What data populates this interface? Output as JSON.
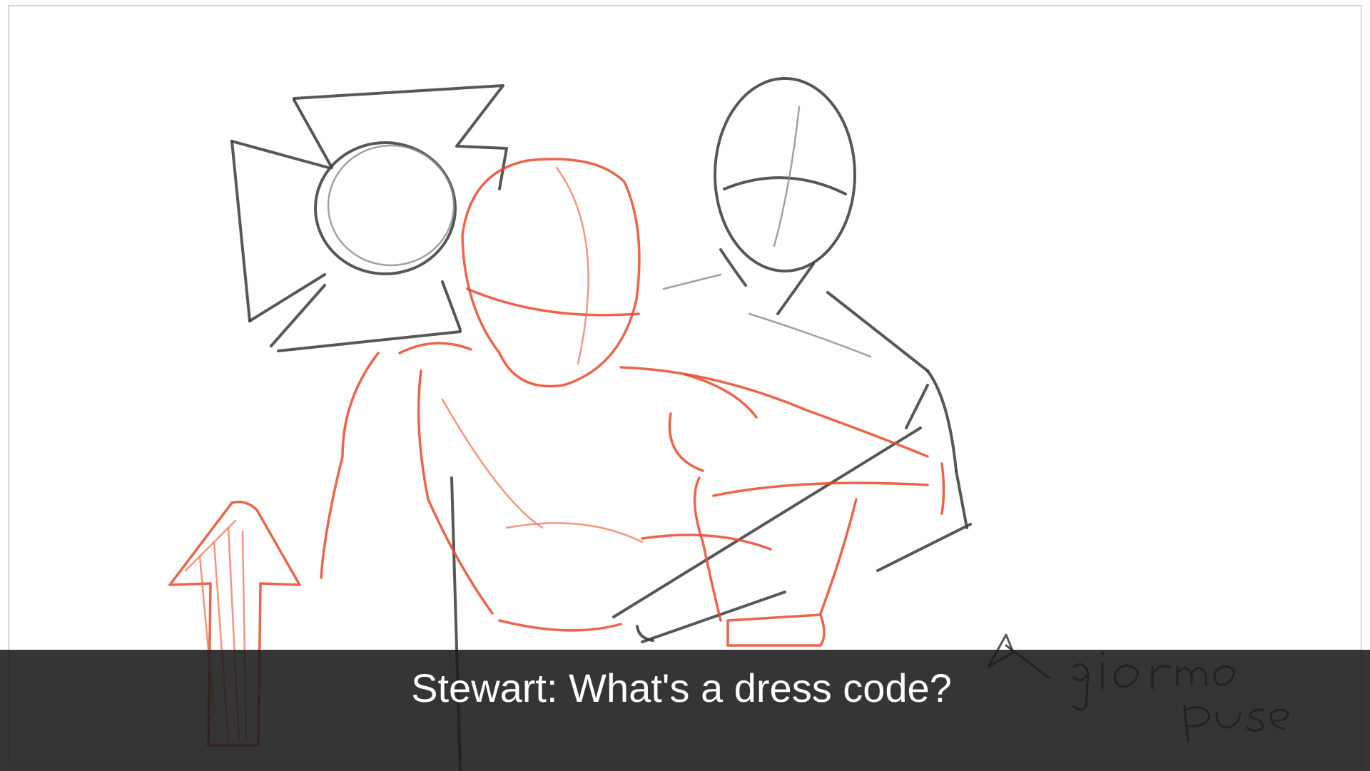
{
  "subtitle": {
    "text": "Stewart: What's a dress code?"
  },
  "sketch": {
    "note_text": "giorno pose",
    "colors": {
      "pencil_black": "#3a3a3a",
      "pencil_red": "#e8492c",
      "subtitle_bar": "#1c1c1c",
      "subtitle_text": "#ffffff"
    }
  }
}
